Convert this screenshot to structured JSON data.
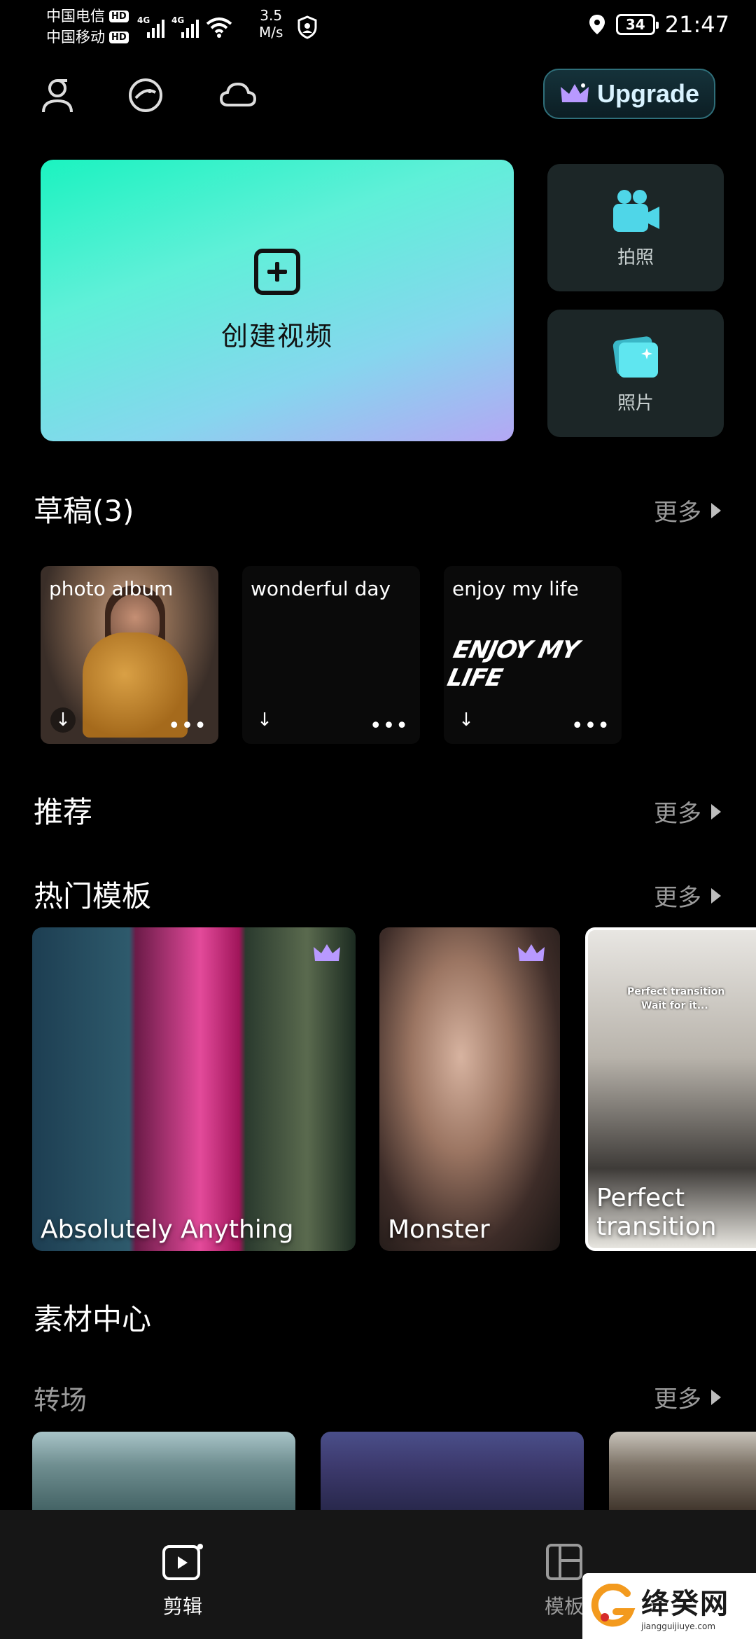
{
  "status_bar": {
    "carrier1": "中国电信",
    "carrier2": "中国移动",
    "hd_badge": "HD",
    "network_tag": "4G",
    "speed_value": "3.5",
    "speed_unit": "M/s",
    "battery": "34",
    "time": "21:47"
  },
  "header": {
    "upgrade_label": "Upgrade"
  },
  "create": {
    "create_video_label": "创建视频",
    "camera_label": "拍照",
    "photos_label": "照片"
  },
  "drafts": {
    "title": "草稿(3)",
    "more_label": "更多",
    "items": [
      {
        "name": "photo album"
      },
      {
        "name": "wonderful day"
      },
      {
        "name": "enjoy my life",
        "art_text": "ENJOY MY LIFE"
      }
    ]
  },
  "recommended": {
    "title": "推荐",
    "more_label": "更多"
  },
  "hot_templates": {
    "title": "热门模板",
    "more_label": "更多",
    "items": [
      {
        "label": "Absolutely Anything",
        "premium": true
      },
      {
        "label": "Monster",
        "premium": true
      },
      {
        "label": "Perfect transition",
        "caption1": "Perfect transition",
        "caption2": "Wait for it..."
      }
    ]
  },
  "materials": {
    "title": "素材中心",
    "transitions_title": "转场",
    "more_label": "更多"
  },
  "bottom_nav": {
    "edit_label": "剪辑",
    "templates_label": "模板"
  },
  "watermark": {
    "brand": "绛癸网",
    "url": "jiangguijiuye.com"
  },
  "colors": {
    "background": "#000000",
    "create_gradient_start": "#1bf3c0",
    "create_gradient_end": "#b4a7f4",
    "camera_icon": "#4fd6e8",
    "crown": "#b899ff"
  }
}
